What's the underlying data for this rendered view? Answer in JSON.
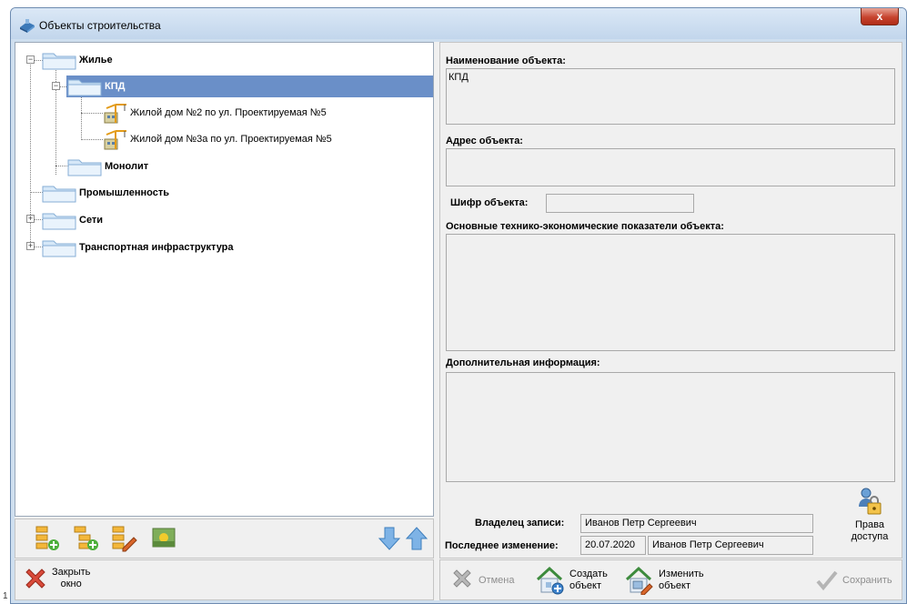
{
  "window": {
    "title": "Объекты строительства",
    "close_glyph": "x"
  },
  "tree": {
    "nodes": [
      {
        "label": "Жилье",
        "expander": "−"
      },
      {
        "label": "КПД",
        "expander": "−",
        "selected": true
      },
      {
        "label": "Жилой дом №2 по ул. Проектируемая №5"
      },
      {
        "label": "Жилой дом №3а по ул. Проектируемая №5"
      },
      {
        "label": "Монолит"
      },
      {
        "label": "Промышленность"
      },
      {
        "label": "Сети",
        "expander": "+"
      },
      {
        "label": "Транспортная инфраструктура",
        "expander": "+"
      }
    ],
    "toolbar_icons": [
      "add-child-node-icon",
      "add-sibling-node-icon",
      "edit-node-icon",
      "image-icon",
      "move-down-icon",
      "move-up-icon"
    ]
  },
  "left_bottom": {
    "close_label_line1": "Закрыть",
    "close_label_line2": "окно"
  },
  "form": {
    "name_label": "Наименование объекта:",
    "name_value": "КПД",
    "address_label": "Адрес объекта:",
    "address_value": "",
    "code_label": "Шифр объекта:",
    "code_value": "",
    "indicators_label": "Основные технико-экономические показатели объекта:",
    "indicators_value": "",
    "additional_label": "Дополнительная информация:",
    "additional_value": "",
    "owner_label": "Владелец записи:",
    "owner_value": "Иванов Петр Сергеевич",
    "modified_label": "Последнее изменение:",
    "modified_date": "20.07.2020",
    "modified_user": "Иванов Петр Сергеевич",
    "access_line1": "Права",
    "access_line2": "доступа"
  },
  "actions": {
    "cancel": "Отмена",
    "create_line1": "Создать",
    "create_line2": "объект",
    "edit_line1": "Изменить",
    "edit_line2": "объект",
    "save": "Сохранить"
  },
  "page_number": "1",
  "colors": {
    "selection": "#6a8fc8",
    "titlebar": "#c2d6ec",
    "close_button": "#c7442f"
  }
}
